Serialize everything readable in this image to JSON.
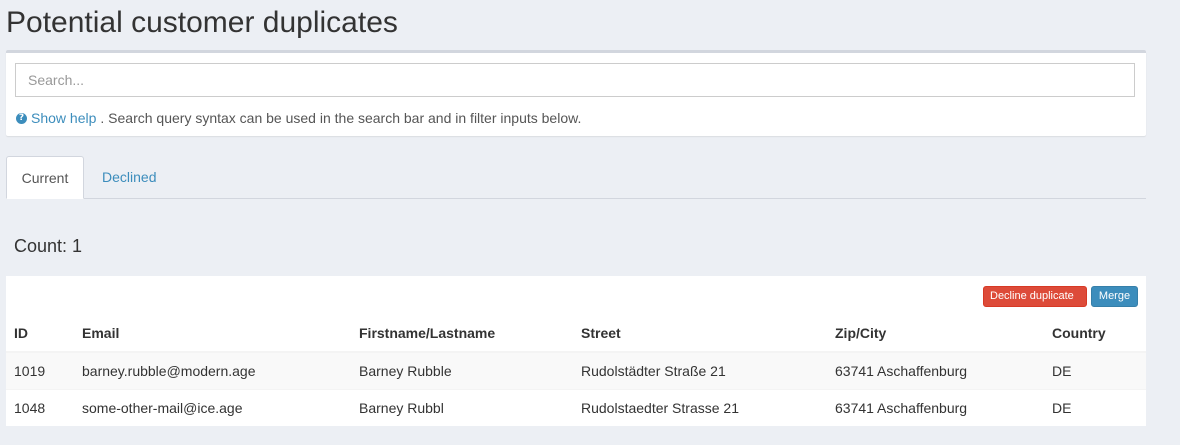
{
  "page": {
    "title": "Potential customer duplicates"
  },
  "search": {
    "placeholder": "Search...",
    "help_link": "Show help",
    "help_text": ". Search query syntax can be used in the search bar and in filter inputs below."
  },
  "tabs": [
    {
      "label": "Current",
      "active": true
    },
    {
      "label": "Declined",
      "active": false
    }
  ],
  "count": {
    "label": "Count: 1"
  },
  "actions": {
    "decline_label": "Decline duplicate",
    "merge_label": "Merge"
  },
  "table": {
    "columns": [
      "ID",
      "Email",
      "Firstname/Lastname",
      "Street",
      "Zip/City",
      "Country"
    ],
    "rows": [
      [
        "1019",
        "barney.rubble@modern.age",
        "Barney Rubble",
        "Rudolstädter Straße 21",
        "63741 Aschaffenburg",
        "DE"
      ],
      [
        "1048",
        "some-other-mail@ice.age",
        "Barney Rubbl",
        "Rudolstaedter Strasse 21",
        "63741 Aschaffenburg",
        "DE"
      ]
    ]
  },
  "colors": {
    "accent": "#3c8dbc",
    "danger": "#dd4b39",
    "background": "#eceff4"
  },
  "icons": {
    "help": "question-circle-icon"
  }
}
